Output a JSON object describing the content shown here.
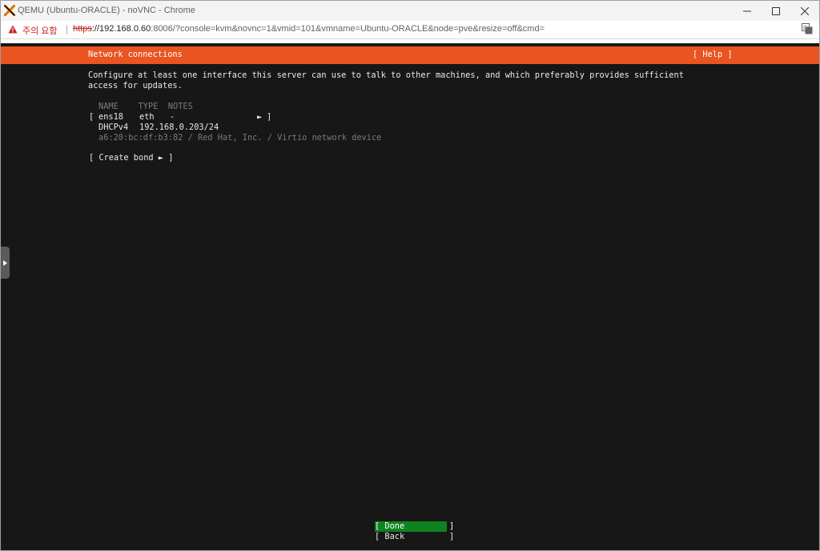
{
  "window": {
    "title": "QEMU (Ubuntu-ORACLE) - noVNC - Chrome"
  },
  "address_bar": {
    "security_warning": "주의 요함",
    "url_scheme": "https",
    "url_host": "://192.168.0.60",
    "url_rest": ":8006/?console=kvm&novnc=1&vmid=101&vmname=Ubuntu-ORACLE&node=pve&resize=off&cmd="
  },
  "installer": {
    "header_title": "Network connections",
    "help_label": "[ Help ]",
    "description_line1": "Configure at least one interface this server can use to talk to other machines, and which preferably provides sufficient",
    "description_line2": "access for updates.",
    "table_header": "NAME    TYPE  NOTES",
    "interface": {
      "bracket_open": "[",
      "name": "ens18",
      "type": "eth",
      "notes": "-",
      "arrow": "►",
      "bracket_close": "]",
      "dhcp_label": "DHCPv4",
      "dhcp_address": "192.168.0.203/24",
      "hw_info": "a6:20:bc:df:b3:82 / Red Hat, Inc. / Virtio network device"
    },
    "create_bond": "[ Create bond ► ]",
    "done_button": "[ Done         ]",
    "back_button": "[ Back         ]"
  },
  "colors": {
    "header_orange": "#e95420",
    "done_green": "#0e8420",
    "console_bg": "#171717"
  }
}
